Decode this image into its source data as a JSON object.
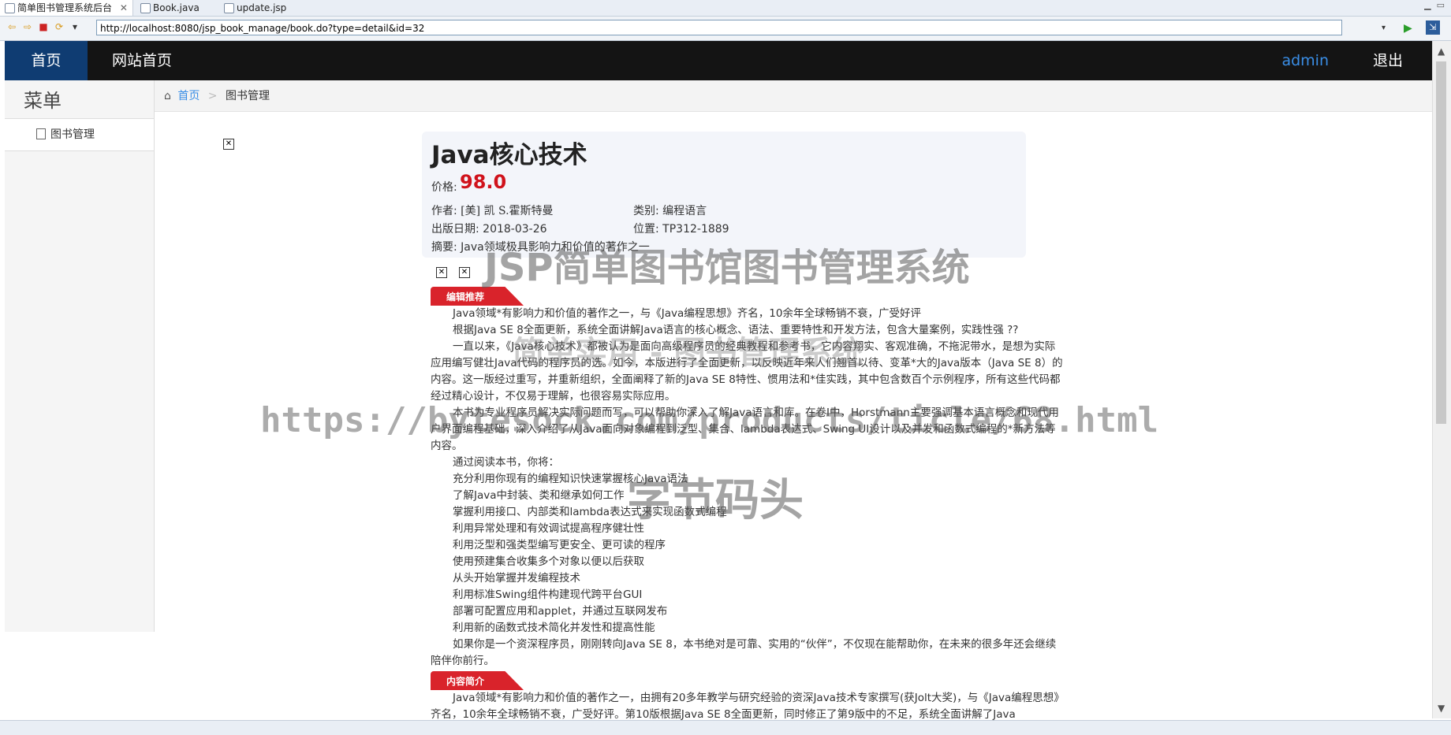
{
  "editor_tabs": [
    {
      "label": "简单图书管理系统后台"
    },
    {
      "label": "Book.java"
    },
    {
      "label": "update.jsp"
    }
  ],
  "browser": {
    "url": "http://localhost:8080/jsp_book_manage/book.do?type=detail&id=32"
  },
  "topnav": {
    "home": "首页",
    "site_home": "网站首页",
    "user": "admin",
    "logout": "退出"
  },
  "sidebar": {
    "title": "菜单",
    "items": [
      {
        "label": "图书管理"
      }
    ]
  },
  "breadcrumb": {
    "home": "首页",
    "separator": ">",
    "current": "图书管理"
  },
  "book": {
    "title": "Java核心技术",
    "price_label": "价格:",
    "price": "98.0",
    "author_label": "作者:",
    "author": "[美] 凯 S.霍斯特曼",
    "category_label": "类别:",
    "category": "编程语言",
    "date_label": "出版日期:",
    "date": "2018-03-26",
    "location_label": "位置:",
    "location": "TP312-1889",
    "summary_label": "摘要:",
    "summary": "Java领域极具影响力和价值的著作之一"
  },
  "sections": {
    "editor_pick": "编辑推荐",
    "intro": "内容简介"
  },
  "editor_pick_paras": [
    "Java领域*有影响力和价值的著作之一，与《Java编程思想》齐名，10余年全球畅销不衰，广受好评",
    "根据Java SE 8全面更新，系统全面讲解Java语言的核心概念、语法、重要特性和开发方法，包含大量案例，实践性强 ??",
    "一直以来，《Java核心技术》都被认为是面向高级程序员的经典教程和参考书，它内容翔实、客观准确，不拖泥带水，是想为实际应用编写健壮Java代码的程序员的选。如今，本版进行了全面更新，以反映近年来人们翘首以待、变革*大的Java版本（Java SE 8）的内容。这一版经过重写，并重新组织，全面阐释了新的Java SE 8特性、惯用法和*佳实践，其中包含数百个示例程序，所有这些代码都经过精心设计，不仅易于理解，也很容易实际应用。",
    "本书为专业程序员解决实际问题而写，可以帮助你深入了解Java语言和库。在卷I中，Horstmann主要强调基本语言概念和现代用户界面编程基础，深入介绍了从Java面向对象编程到泛型、集合、lambda表达式、Swing UI设计以及并发和函数式编程的*新方法等内容。",
    "通过阅读本书，你将：",
    "充分利用你现有的编程知识快速掌握核心Java语法",
    "了解Java中封装、类和继承如何工作",
    "掌握利用接口、内部类和lambda表达式来实现函数式编程",
    "利用异常处理和有效调试提高程序健壮性",
    "利用泛型和强类型编写更安全、更可读的程序",
    "使用预建集合收集多个对象以便以后获取",
    "从头开始掌握并发编程技术",
    "利用标准Swing组件构建现代跨平台GUI",
    "部署可配置应用和applet，并通过互联网发布",
    "利用新的函数式技术简化并发性和提高性能",
    "如果你是一个资深程序员，刚刚转向Java SE 8，本书绝对是可靠、实用的“伙伴”，不仅现在能帮助你，在未来的很多年还会继续陪伴你前行。"
  ],
  "intro_paras": [
    "Java领域*有影响力和价值的著作之一，由拥有20多年教学与研究经验的资深Java技术专家撰写(获Jolt大奖)，与《Java编程思想》齐名，10余年全球畅销不衰，广受好评。第10版根据Java SE 8全面更新，同时修正了第9版中的不足，系统全面讲解了Java"
  ],
  "watermarks": {
    "w1": "JSP简单图书馆图书管理系统",
    "w2": "简单实用 - 图书管理系统",
    "w3": "https://bytesock.com/products/ticle/68.html",
    "w4": "字节码头"
  },
  "colors": {
    "nav_bg": "#141414",
    "nav_active": "#0f3c72",
    "price": "#d0121b",
    "tag": "#d9232b",
    "link": "#3a8ee6"
  }
}
